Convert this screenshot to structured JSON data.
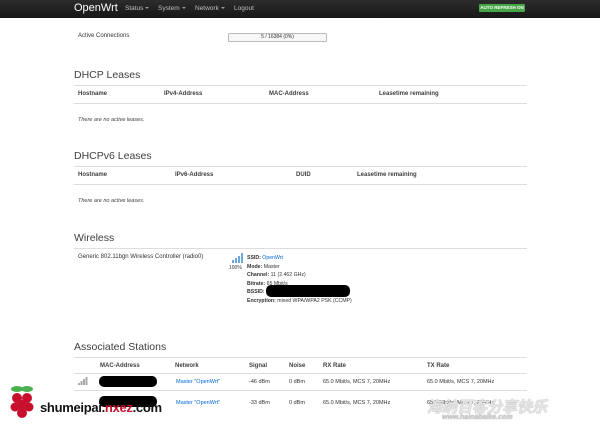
{
  "nav": {
    "brand": "OpenWrt",
    "status": "Status",
    "system": "System",
    "network": "Network",
    "logout": "Logout",
    "auto_refresh": "AUTO REFRESH ON"
  },
  "active_connections": {
    "label": "Active Connections",
    "value": "5 / 16384 (0%)",
    "fill_percent": 0
  },
  "dhcp": {
    "title": "DHCP Leases",
    "headers": [
      "Hostname",
      "IPv4-Address",
      "MAC-Address",
      "Leasetime remaining"
    ],
    "empty": "There are no active leases."
  },
  "dhcpv6": {
    "title": "DHCPv6 Leases",
    "headers": [
      "Hostname",
      "IPv6-Address",
      "DUID",
      "Leasetime remaining"
    ],
    "empty": "There are no active leases."
  },
  "wireless": {
    "title": "Wireless",
    "device": "Generic 802.11bgn Wireless Controller (radio0)",
    "signal_percent": "100%",
    "ssid_label": "SSID:",
    "ssid_value": "OpenWrt",
    "mode_label": "Mode:",
    "mode_value": "Master",
    "channel_label": "Channel:",
    "channel_value": "11 (2.462 GHz)",
    "bitrate_label": "Bitrate:",
    "bitrate_value": "65 Mbit/s",
    "bssid_label": "BSSID:",
    "encryption_label": "Encryption:",
    "encryption_value": "mixed WPA/WPA2 PSK (CCMP)"
  },
  "stations": {
    "title": "Associated Stations",
    "headers": [
      "MAC-Address",
      "Network",
      "Signal",
      "Noise",
      "RX Rate",
      "TX Rate"
    ],
    "rows": [
      {
        "network": "Master \"OpenWrt\"",
        "signal": "-46 dBm",
        "noise": "0 dBm",
        "rx": "65.0 Mbit/s, MCS 7, 20MHz",
        "tx": "65.0 Mbit/s, MCS 7, 20MHz"
      },
      {
        "network": "Master \"OpenWrt\"",
        "signal": "-33 dBm",
        "noise": "0 dBm",
        "rx": "65.0 Mbit/s, MCS 7, 20MHz",
        "tx": "65.0 Mbit/s, MCS 7, 20MHz"
      }
    ]
  },
  "watermarks": {
    "left_prefix": "shumeipai.",
    "left_domain": "nxez",
    "left_suffix": ".com",
    "right_cn": "海纳百客分享快乐",
    "right_url": "www.hainabaike.com"
  }
}
